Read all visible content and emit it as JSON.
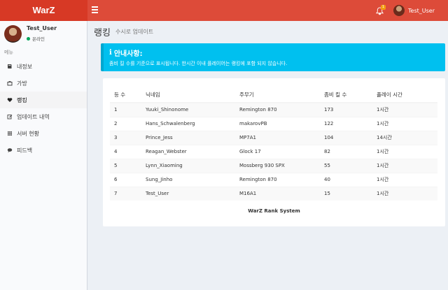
{
  "app": {
    "logo": "WarZ"
  },
  "navbar": {
    "notification_count": "1",
    "user_name": "Test_User"
  },
  "sidebar": {
    "user": {
      "name": "Test_User",
      "status": "온라인"
    },
    "menu_header": "메뉴",
    "items": [
      {
        "label": "내정보",
        "icon": "book-icon"
      },
      {
        "label": "가방",
        "icon": "bag-icon"
      },
      {
        "label": "랭킹",
        "icon": "heart-icon"
      },
      {
        "label": "업데이트 내역",
        "icon": "edit-icon"
      },
      {
        "label": "서버 현황",
        "icon": "grid-icon"
      },
      {
        "label": "피드백",
        "icon": "chat-icon"
      }
    ]
  },
  "header": {
    "title": "랭킹",
    "subtitle": "수시로 업데이트"
  },
  "callout": {
    "title": "안내사항:",
    "text": "좀비 킬 수를 기준으로 표시됩니다. 한시간 이내 플레이어는 랭킹에 포함 되지 않습니다.",
    "color": "#00c0ef"
  },
  "table": {
    "headers": [
      "등 수",
      "닉네임",
      "주무기",
      "좀비 킬 수",
      "플레이 시간"
    ],
    "rows": [
      [
        "1",
        "Yuuki_Shinonome",
        "Remington 870",
        "173",
        "1시간"
      ],
      [
        "2",
        "Hans_Schwalenberg",
        "makarovPB",
        "122",
        "1시간"
      ],
      [
        "3",
        "Prince_Jess",
        "MP7A1",
        "104",
        "14시간"
      ],
      [
        "4",
        "Reagan_Webster",
        "Glock 17",
        "82",
        "1시간"
      ],
      [
        "5",
        "Lynn_Xiaoming",
        "Mossberg 930 SPX",
        "55",
        "1시간"
      ],
      [
        "6",
        "Sung_Jinho",
        "Remington 870",
        "40",
        "1시간"
      ],
      [
        "7",
        "Test_User",
        "M16A1",
        "15",
        "1시간"
      ]
    ]
  },
  "footer": {
    "text": "WarZ Rank System"
  },
  "colors": {
    "header_bg": "#dd4b39",
    "logo_bg": "#d73925",
    "status_online": "#00a65a"
  }
}
